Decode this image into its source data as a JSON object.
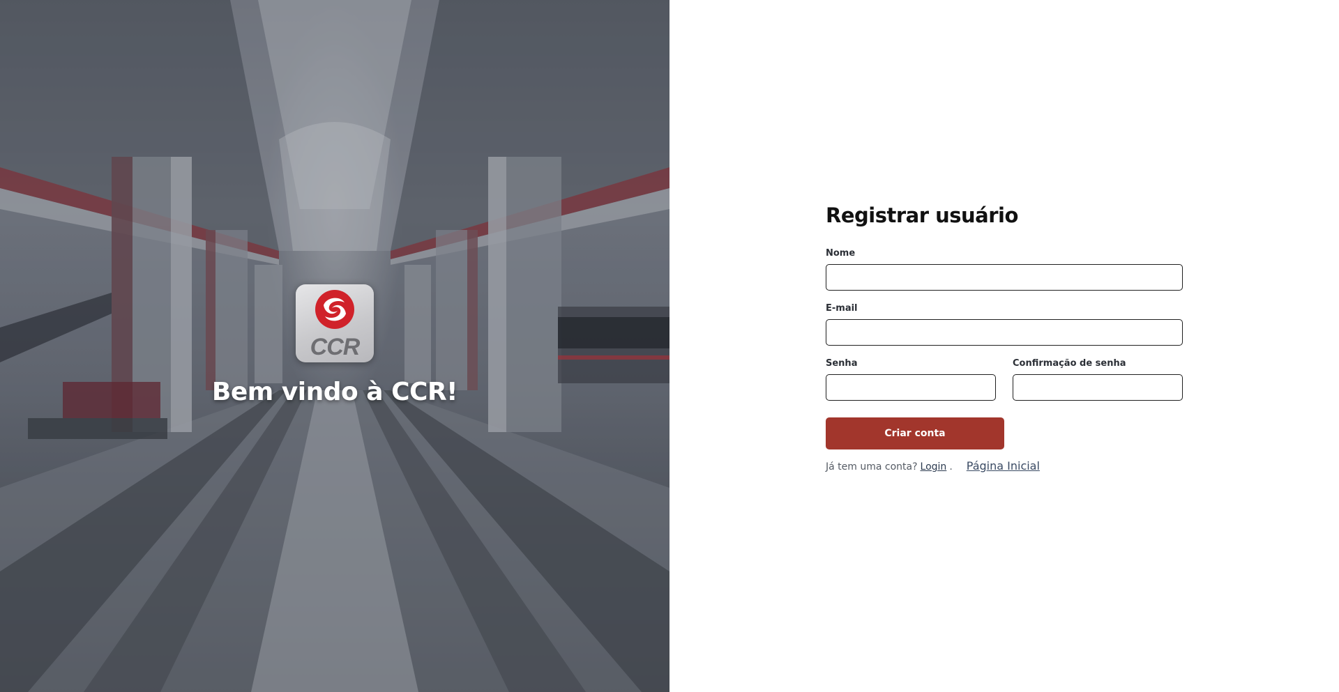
{
  "hero": {
    "logo_text": "CCR",
    "welcome": "Bem vindo à CCR!"
  },
  "form": {
    "title": "Registrar usuário",
    "name_label": "Nome",
    "name_value": "",
    "email_label": "E-mail",
    "email_value": "",
    "password_label": "Senha",
    "password_value": "",
    "confirm_label": "Confirmação de senha",
    "confirm_value": "",
    "submit_label": "Criar conta",
    "have_account_text": "Já tem uma conta?",
    "login_link": "Login",
    "period": ".",
    "home_link": "Página Inicial"
  },
  "colors": {
    "brand_red": "#a2362c",
    "logo_red": "#d0222a",
    "text_dark": "#111111"
  },
  "icons": {
    "logo": "ccr-swirl-logo"
  }
}
